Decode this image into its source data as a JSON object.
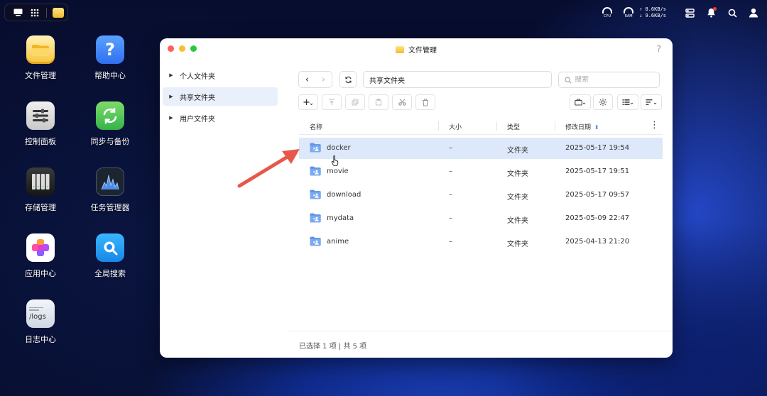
{
  "tray": {
    "cpu_label": "CPU",
    "ram_label": "RAM",
    "upload": "↑ 8.6KB/s",
    "download": "↓ 9.6KB/s"
  },
  "desktop": {
    "icons": [
      {
        "label": "文件管理"
      },
      {
        "label": "帮助中心"
      },
      {
        "label": "控制面板"
      },
      {
        "label": "同步与备份"
      },
      {
        "label": "存储管理"
      },
      {
        "label": "任务管理器"
      },
      {
        "label": "应用中心"
      },
      {
        "label": "全局搜索"
      },
      {
        "label": "日志中心"
      }
    ],
    "logs_tile_text": "/logs"
  },
  "window": {
    "title": "文件管理",
    "help": "?"
  },
  "sidebar": {
    "items": [
      {
        "label": "个人文件夹"
      },
      {
        "label": "共享文件夹"
      },
      {
        "label": "用户文件夹"
      }
    ]
  },
  "nav": {
    "back": "‹",
    "forward": "›",
    "path": "共享文件夹",
    "search_placeholder": "搜索"
  },
  "table": {
    "headers": {
      "name": "名称",
      "size": "大小",
      "type": "类型",
      "modified": "修改日期"
    },
    "rows": [
      {
        "name": "docker",
        "size": "–",
        "type": "文件夹",
        "modified": "2025-05-17 19:54"
      },
      {
        "name": "movie",
        "size": "–",
        "type": "文件夹",
        "modified": "2025-05-17 19:51"
      },
      {
        "name": "download",
        "size": "–",
        "type": "文件夹",
        "modified": "2025-05-17 09:57"
      },
      {
        "name": "mydata",
        "size": "–",
        "type": "文件夹",
        "modified": "2025-05-09 22:47"
      },
      {
        "name": "anime",
        "size": "–",
        "type": "文件夹",
        "modified": "2025-04-13 21:20"
      }
    ]
  },
  "status": {
    "text": "已选择 1 项 | 共 5 项"
  },
  "colors": {
    "accent": "#3d7be3",
    "selected_row": "#dde8fb",
    "annotation_arrow": "#e8584a"
  }
}
